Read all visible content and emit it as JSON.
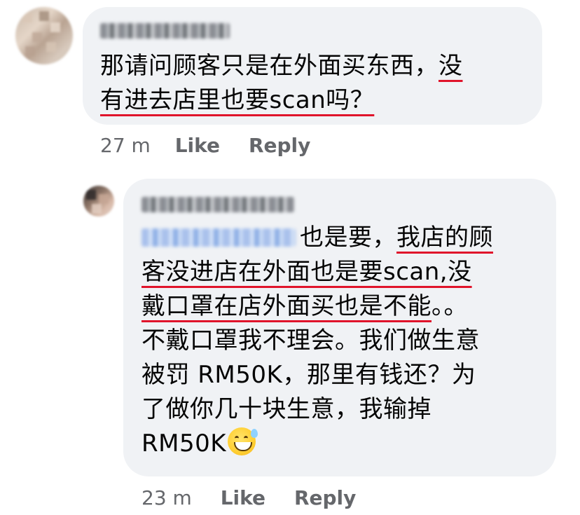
{
  "comment1": {
    "text_lines": [
      [
        "那请问顾客只是在外面买东西，",
        "没"
      ],
      [
        "有进去店里也要scan吗？"
      ]
    ],
    "time": "27 m",
    "like": "Like",
    "reply": "Reply"
  },
  "comment2": {
    "line1_after_mention": "也是要，",
    "line1_underlined": "我店的顾",
    "line2": "客没进店在外面也是要scan,没",
    "line3_underlined": "戴口罩在店外面买也是不能",
    "line3_tail": "。。",
    "line4": "不戴口罩我不理会。我们做生意",
    "line5": "被罚 RM50K，那里有钱还？为",
    "line6": "了做你几十块生意，我输掉",
    "line7": "RM50K",
    "emoji_icon": "sweat-smile-emoji",
    "time": "23 m",
    "like": "Like",
    "reply": "Reply"
  },
  "colors": {
    "bubble": "#f0f2f5",
    "meta": "#65676b",
    "underline": "#e0142b"
  }
}
